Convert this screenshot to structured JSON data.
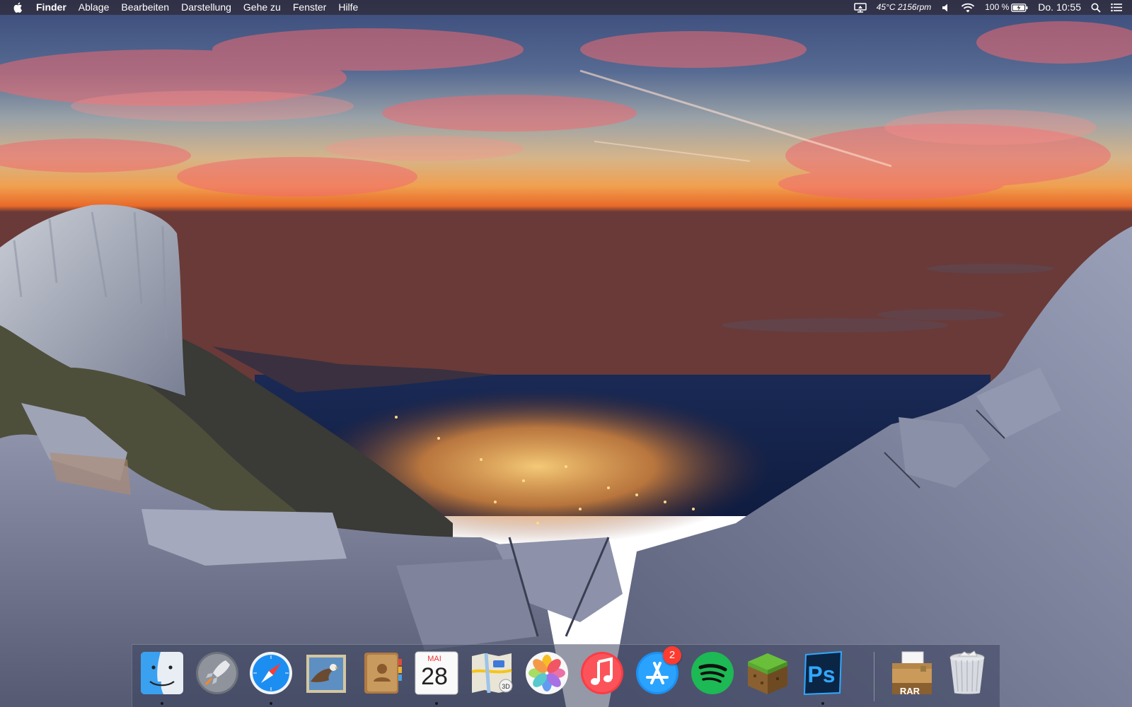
{
  "menubar": {
    "app_name": "Finder",
    "menus": [
      "Ablage",
      "Bearbeiten",
      "Darstellung",
      "Gehe zu",
      "Fenster",
      "Hilfe"
    ],
    "status": {
      "sensor": "45°C 2156rpm",
      "battery": "100 %",
      "clock": "Do. 10:55"
    },
    "icons": [
      "apple-icon",
      "display-icon",
      "volume-icon",
      "wifi-icon",
      "battery-icon",
      "spotlight-icon",
      "notification-center-icon"
    ]
  },
  "dock": {
    "apps": [
      {
        "name": "Finder",
        "icon": "finder-icon",
        "running": true
      },
      {
        "name": "Launchpad",
        "icon": "launchpad-icon",
        "running": false
      },
      {
        "name": "Safari",
        "icon": "safari-icon",
        "running": true
      },
      {
        "name": "Mail",
        "icon": "mail-icon",
        "running": false
      },
      {
        "name": "Kontakte",
        "icon": "contacts-icon",
        "running": false
      },
      {
        "name": "Kalender",
        "icon": "calendar-icon",
        "running": true
      },
      {
        "name": "Karten",
        "icon": "maps-icon",
        "running": false
      },
      {
        "name": "Fotos",
        "icon": "photos-icon",
        "running": false
      },
      {
        "name": "iTunes",
        "icon": "itunes-icon",
        "running": false
      },
      {
        "name": "App Store",
        "icon": "app-store-icon",
        "running": false
      },
      {
        "name": "Spotify",
        "icon": "spotify-icon",
        "running": false
      },
      {
        "name": "Minecraft",
        "icon": "minecraft-icon",
        "running": false
      },
      {
        "name": "Photoshop",
        "icon": "photoshop-icon",
        "running": true
      }
    ],
    "others": [
      {
        "name": "RAR",
        "icon": "rar-archive-icon"
      },
      {
        "name": "Papierkorb",
        "icon": "trash-icon"
      }
    ],
    "calendar": {
      "month": "MAI",
      "day": "28"
    },
    "app_store_badge": "2",
    "rar_label": "RAR",
    "photoshop_label": "Ps"
  },
  "colors": {
    "badge": "#ff3b30",
    "spotify": "#1db954",
    "photoshop": "#31a8ff"
  }
}
